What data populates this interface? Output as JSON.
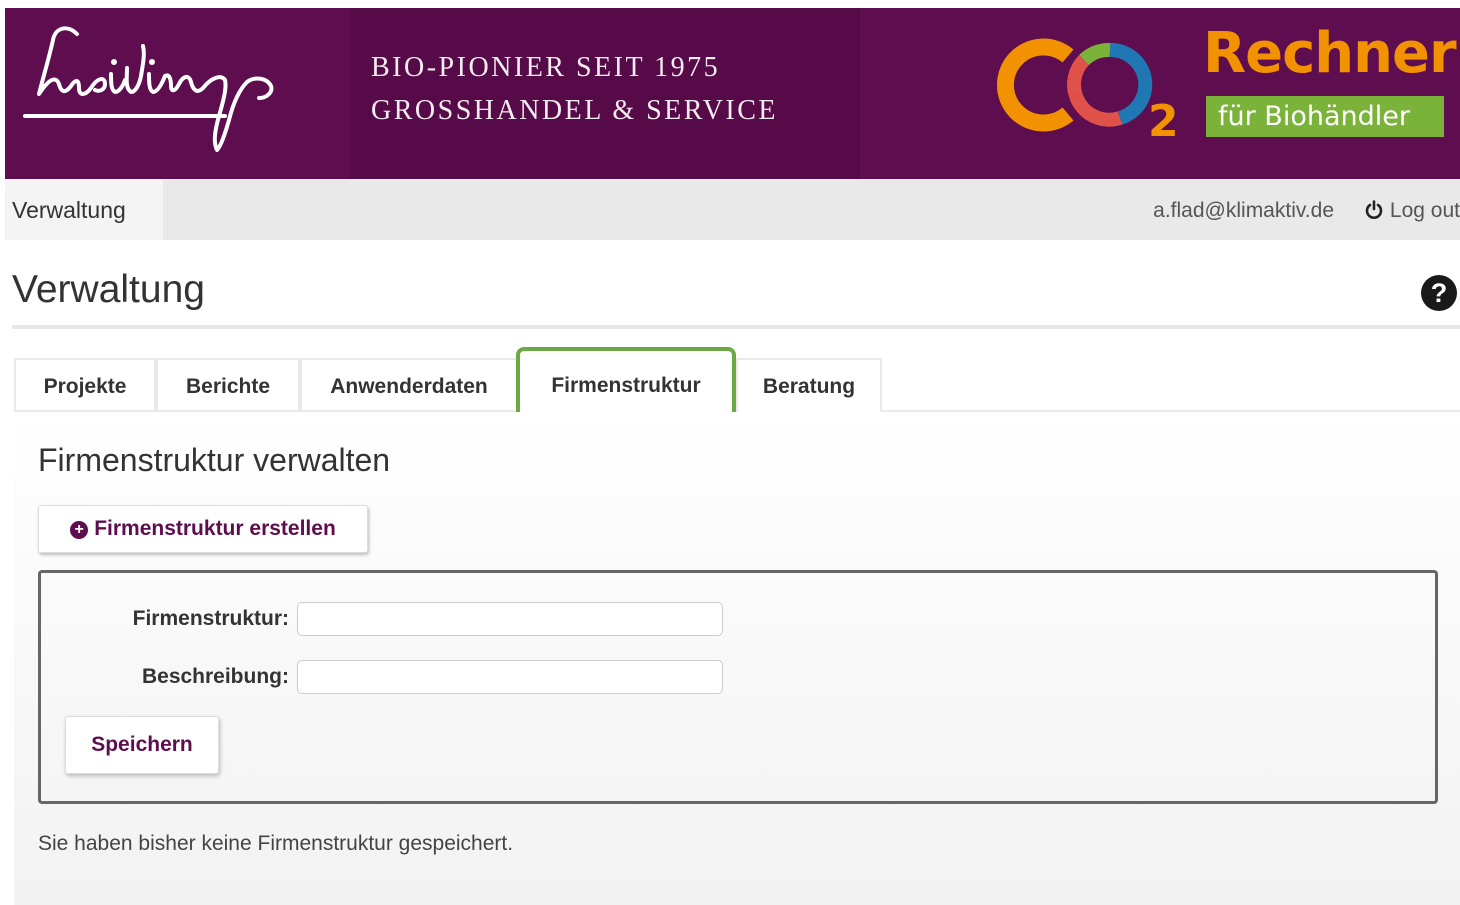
{
  "banner": {
    "tagline_line1": "BIO-PIONIER SEIT 1975",
    "tagline_line2": "GROSSHANDEL & SERVICE",
    "rechner": "Rechner",
    "biohaendler": "für Biohändler",
    "co2_subscript": "2",
    "logo_text": "weiling"
  },
  "nav": {
    "active_item": "Verwaltung",
    "email": "a.flad@klimaktiv.de",
    "logout": "Log out"
  },
  "page": {
    "title": "Verwaltung",
    "help": "?"
  },
  "tabs": [
    {
      "label": "Projekte"
    },
    {
      "label": "Berichte"
    },
    {
      "label": "Anwenderdaten"
    },
    {
      "label": "Firmenstruktur",
      "active": true
    },
    {
      "label": "Beratung"
    }
  ],
  "panel": {
    "title": "Firmenstruktur verwalten",
    "create_button": "Firmenstruktur erstellen",
    "form": {
      "label_firmenstruktur": "Firmenstruktur:",
      "value_firmenstruktur": "",
      "label_beschreibung": "Beschreibung:",
      "value_beschreibung": "",
      "save_button": "Speichern"
    },
    "empty_note": "Sie haben bisher keine Firmenstruktur gespeichert."
  },
  "colors": {
    "brand_purple": "#5e0d4f",
    "accent_orange": "#f39200",
    "accent_green": "#7bb23a",
    "tab_highlight": "#6ca844"
  }
}
